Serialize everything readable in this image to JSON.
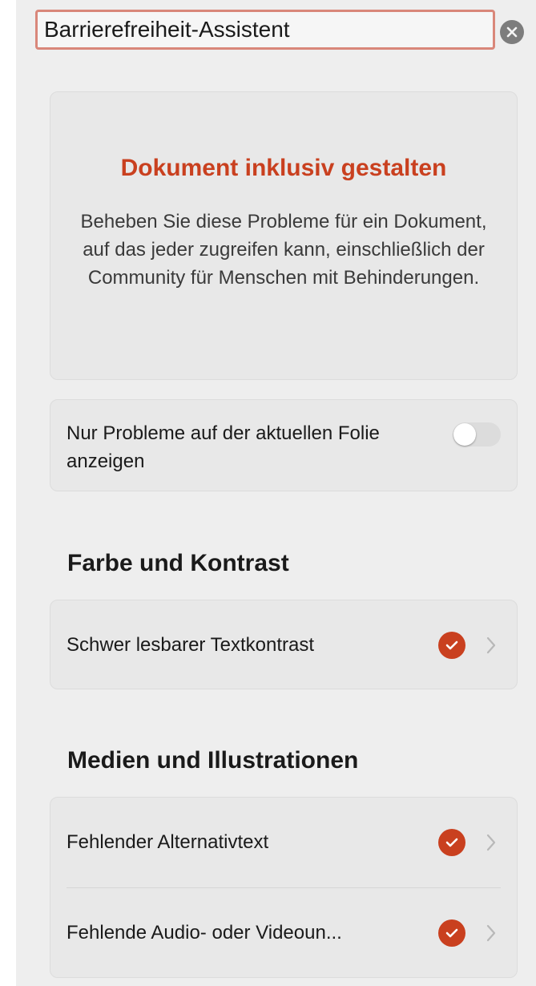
{
  "panel": {
    "title": "Barrierefreiheit-Assistent"
  },
  "intro": {
    "heading": "Dokument inklusiv gestalten",
    "body": "Beheben Sie diese Probleme für ein Dokument, auf das jeder zugreifen kann, einschließlich der Community für Menschen mit Behinderungen."
  },
  "filter_toggle": {
    "label": "Nur Probleme auf der aktuellen Folie anzeigen",
    "enabled": false
  },
  "sections": [
    {
      "heading": "Farbe und Kontrast",
      "items": [
        {
          "label": "Schwer lesbarer Textkontrast",
          "status": "checked"
        }
      ]
    },
    {
      "heading": "Medien und Illustrationen",
      "items": [
        {
          "label": "Fehlender Alternativtext",
          "status": "checked"
        },
        {
          "label": "Fehlende Audio- oder Videoun...",
          "status": "checked"
        }
      ]
    }
  ],
  "colors": {
    "accent": "#c9401f",
    "title_field_border": "#d9877a",
    "panel_background": "#eeeeee",
    "card_background": "#e8e8e8"
  },
  "icons": {
    "close": "close-circle-icon",
    "status": "checkmark-circle-icon",
    "row_arrow": "chevron-right-icon"
  }
}
